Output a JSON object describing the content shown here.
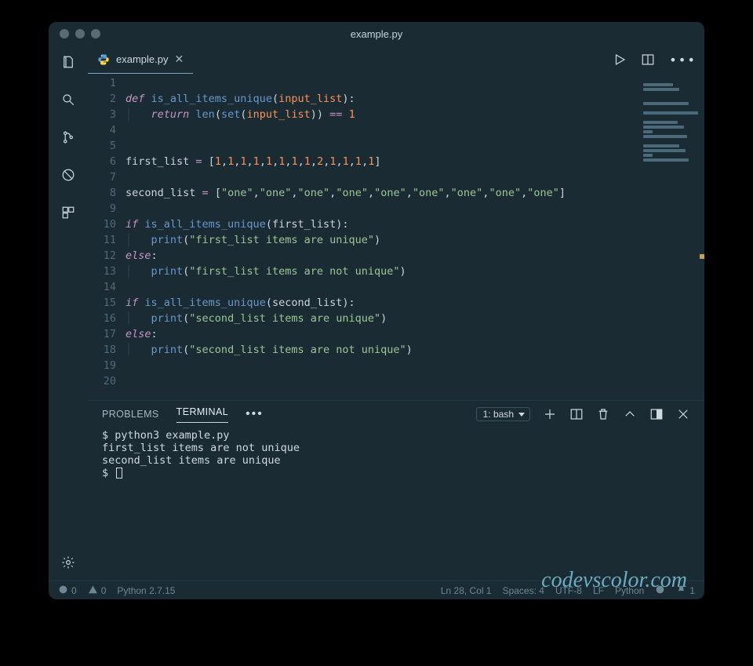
{
  "title": "example.py",
  "tab": {
    "label": "example.py"
  },
  "code": {
    "line_count": 20,
    "lines": [
      {
        "n": 1,
        "type": "blank"
      },
      {
        "n": 2,
        "type": "def",
        "fn": "is_all_items_unique",
        "param": "input_list"
      },
      {
        "n": 3,
        "type": "return_len_set",
        "param": "input_list",
        "cmp": "1"
      },
      {
        "n": 4,
        "type": "blank"
      },
      {
        "n": 5,
        "type": "blank"
      },
      {
        "n": 6,
        "type": "assign_list_nums",
        "name": "first_list",
        "values": [
          "1",
          "1",
          "1",
          "1",
          "1",
          "1",
          "1",
          "1",
          "2",
          "1",
          "1",
          "1",
          "1"
        ]
      },
      {
        "n": 7,
        "type": "blank"
      },
      {
        "n": 8,
        "type": "assign_list_strs",
        "name": "second_list",
        "values": [
          "one",
          "one",
          "one",
          "one",
          "one",
          "one",
          "one",
          "one",
          "one"
        ]
      },
      {
        "n": 9,
        "type": "blank"
      },
      {
        "n": 10,
        "type": "if_call",
        "fn": "is_all_items_unique",
        "arg": "first_list"
      },
      {
        "n": 11,
        "type": "print",
        "str": "first_list items are unique"
      },
      {
        "n": 12,
        "type": "else"
      },
      {
        "n": 13,
        "type": "print",
        "str": "first_list items are not unique"
      },
      {
        "n": 14,
        "type": "blank"
      },
      {
        "n": 15,
        "type": "if_call",
        "fn": "is_all_items_unique",
        "arg": "second_list"
      },
      {
        "n": 16,
        "type": "print",
        "str": "second_list items are unique"
      },
      {
        "n": 17,
        "type": "else"
      },
      {
        "n": 18,
        "type": "print",
        "str": "second_list items are not unique"
      },
      {
        "n": 19,
        "type": "blank"
      },
      {
        "n": 20,
        "type": "blank"
      }
    ]
  },
  "panel": {
    "tabs": {
      "problems": "PROBLEMS",
      "terminal": "TERMINAL"
    },
    "terminal_select": "1: bash",
    "terminal_lines": [
      "$ python3 example.py",
      "first_list items are not unique",
      "second_list items are unique",
      "$ "
    ]
  },
  "watermark": "codevscolor.com",
  "status": {
    "errors": "0",
    "warnings": "0",
    "python_version": "Python 2.7.15",
    "position": "Ln 28, Col 1",
    "spaces": "Spaces: 4",
    "encoding": "UTF-8",
    "eol": "LF",
    "language": "Python",
    "notif": "1"
  },
  "minimap_widths": [
    0,
    38,
    46,
    0,
    0,
    58,
    0,
    70,
    0,
    44,
    52,
    12,
    56,
    0,
    46,
    54,
    12,
    58,
    0,
    0
  ],
  "colors": {
    "bg": "#1b2b34"
  }
}
